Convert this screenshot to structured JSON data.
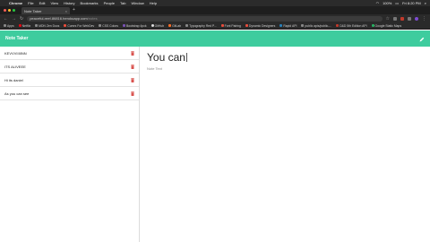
{
  "macos_menu": {
    "apple": "",
    "app": "Chrome",
    "items": [
      "File",
      "Edit",
      "View",
      "History",
      "Bookmarks",
      "People",
      "Tab",
      "Window",
      "Help"
    ],
    "battery": "100%",
    "clock": "Fri 8:20 PM"
  },
  "browser": {
    "tab_title": "Note Taker",
    "tab_close": "×",
    "new_tab": "+",
    "url_host": "peaceful-reef-86816.herokuapp.com",
    "url_path": "/notes",
    "back": "←",
    "forward": "→",
    "reload": "↻"
  },
  "bookmarks": [
    "Apps",
    "Netflix",
    "MDN Zen Docs",
    "Cumrs For WebDev",
    "CSS Colors",
    "Bootstrap 4pck",
    "GitHub",
    "GitLab",
    "Typography Red P...",
    "Font Pairing",
    "Dynamic Designers",
    "Rapid API",
    "public apis/public-...",
    "D&D 5th Edition API",
    "Google Static Maps"
  ],
  "app": {
    "brand": "Note Taker",
    "notes": [
      {
        "title": "KEVVVIIIIINN"
      },
      {
        "title": "ITS ALIVEEE"
      },
      {
        "title": "Hi its daniel"
      },
      {
        "title": "As you can see"
      }
    ],
    "editor": {
      "title": "You can",
      "text_placeholder": "Note Text"
    }
  },
  "colors": {
    "header": "#3ecc9e",
    "delete": "#d9534f",
    "chrome_dark": "#2a2a2a"
  }
}
